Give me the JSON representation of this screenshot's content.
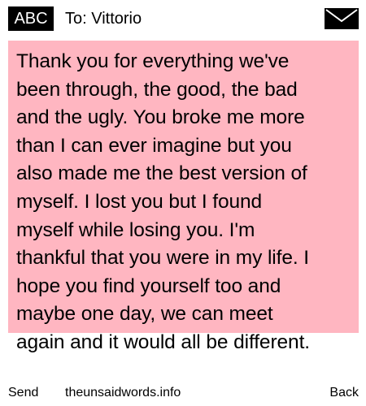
{
  "header": {
    "input_mode": "ABC",
    "recipient": "To: Vittorio",
    "icon": "envelope-icon"
  },
  "message": {
    "body": "Thank you for everything we've\nbeen through, the good, the bad\nand the ugly. You broke me more\nthan I can ever imagine but you\nalso made me the best version of\nmyself. I lost you but I found\nmyself while losing you. I'm\nthankful that you were in my life. I\nhope you find yourself too and\nmaybe one day, we can meet\nagain and it would all be different."
  },
  "footer": {
    "left_softkey": "Send",
    "site": "theunsaidwords.info",
    "right_softkey": "Back"
  },
  "colors": {
    "message_background": "#ffb6c1",
    "header_badge": "#000000"
  }
}
